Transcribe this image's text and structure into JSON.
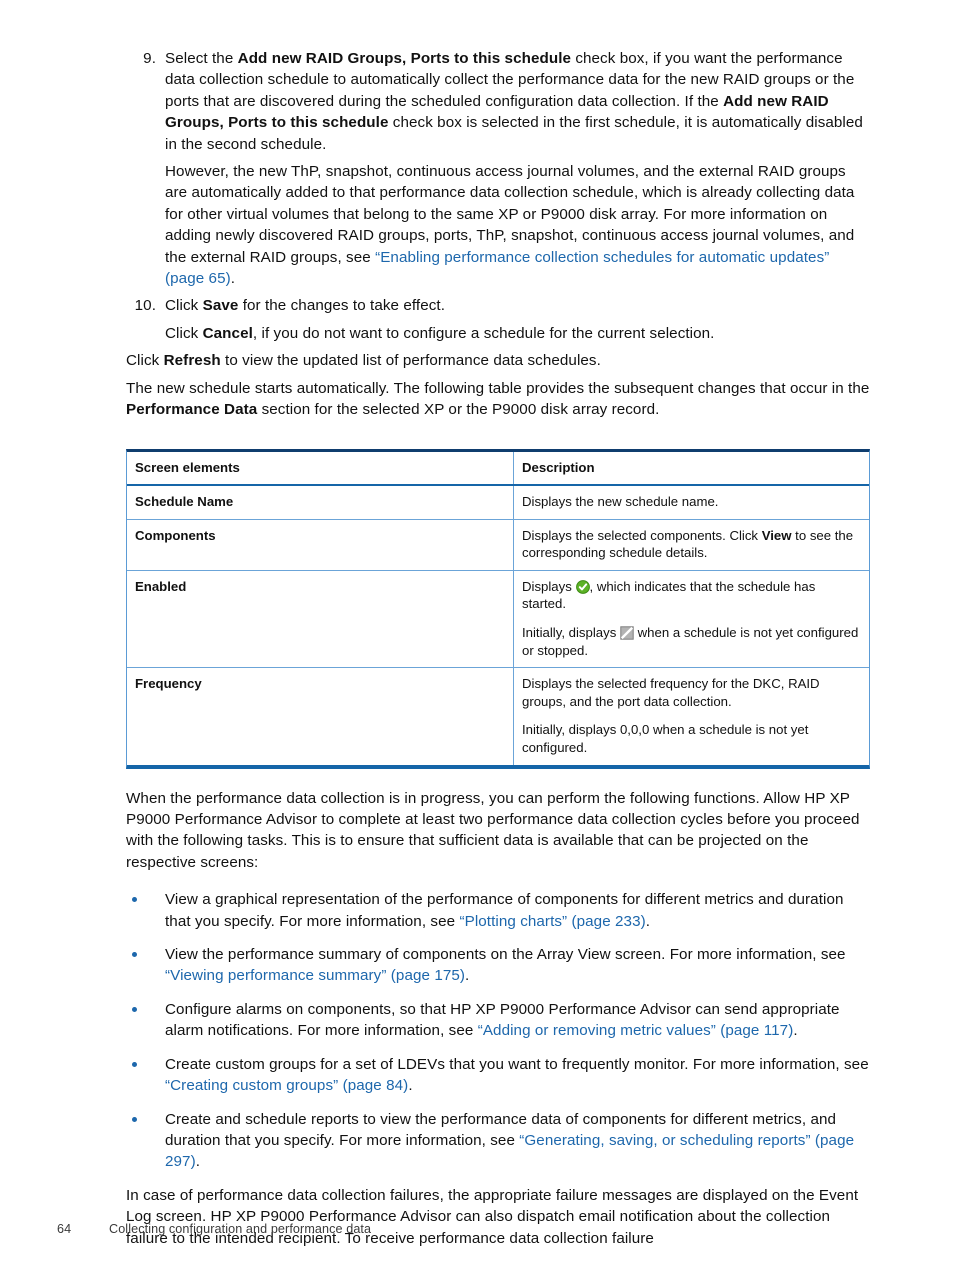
{
  "page": {
    "number": "64",
    "footer_title": "Collecting configuration and performance data"
  },
  "colors": {
    "link": "#1d67ac",
    "table_top_border": "#0f3d6e",
    "table_bottom_border": "#1565a8",
    "table_inner_border": "#6ba4d8",
    "bullet": "#1d67ac",
    "enabled_icon_green": "#5cb226",
    "disabled_icon_gray": "#9a9a9a"
  },
  "steps": [
    {
      "number": "9.",
      "paragraphs": [
        {
          "runs": [
            {
              "t": "Select the ",
              "s": "normal"
            },
            {
              "t": "Add new RAID Groups, Ports to this schedule",
              "s": "bold"
            },
            {
              "t": " check box, if you want the performance data collection schedule to automatically collect the performance data for the new RAID groups or the ports that are discovered during the scheduled configuration data collection. If the ",
              "s": "normal"
            },
            {
              "t": "Add new RAID Groups, Ports to this schedule",
              "s": "bold"
            },
            {
              "t": " check box is selected in the first schedule, it is automatically disabled in the second schedule.",
              "s": "normal"
            }
          ]
        },
        {
          "runs": [
            {
              "t": "However, the new ThP, snapshot, continuous access journal volumes, and the external RAID groups are automatically added to that performance data collection schedule, which is already collecting data for other virtual volumes that belong to the same XP or P9000 disk array. For more information on adding newly discovered RAID groups, ports, ThP, snapshot, continuous access journal volumes, and the external RAID groups, see ",
              "s": "normal"
            },
            {
              "t": "“Enabling performance collection schedules for automatic updates” (page 65)",
              "s": "link"
            },
            {
              "t": ".",
              "s": "normal"
            }
          ]
        }
      ]
    },
    {
      "number": "10.",
      "paragraphs": [
        {
          "runs": [
            {
              "t": "Click ",
              "s": "normal"
            },
            {
              "t": "Save",
              "s": "bold"
            },
            {
              "t": " for the changes to take effect.",
              "s": "normal"
            }
          ]
        },
        {
          "runs": [
            {
              "t": "Click ",
              "s": "normal"
            },
            {
              "t": "Cancel",
              "s": "bold"
            },
            {
              "t": ", if you do not want to configure a schedule for the current selection.",
              "s": "normal"
            }
          ]
        }
      ]
    }
  ],
  "after_steps": [
    {
      "runs": [
        {
          "t": "Click ",
          "s": "normal"
        },
        {
          "t": "Refresh",
          "s": "bold"
        },
        {
          "t": " to view the updated list of performance data schedules.",
          "s": "normal"
        }
      ]
    },
    {
      "runs": [
        {
          "t": "The new schedule starts automatically. The following table provides the subsequent changes that occur in the ",
          "s": "normal"
        },
        {
          "t": "Performance Data",
          "s": "bold"
        },
        {
          "t": " section for the selected XP or the P9000 disk array record.",
          "s": "normal"
        }
      ]
    }
  ],
  "table": {
    "headers": [
      "Screen elements",
      "Description"
    ],
    "rows": [
      {
        "name": "Schedule Name",
        "description": [
          {
            "runs": [
              {
                "t": "Displays the new schedule name.",
                "s": "normal"
              }
            ]
          }
        ]
      },
      {
        "name": "Components",
        "description": [
          {
            "runs": [
              {
                "t": "Displays the selected components. Click ",
                "s": "normal"
              },
              {
                "t": "View",
                "s": "bold"
              },
              {
                "t": " to see the corresponding schedule details.",
                "s": "normal"
              }
            ]
          }
        ]
      },
      {
        "name": "Enabled",
        "description": [
          {
            "runs": [
              {
                "t": "Displays ",
                "s": "normal"
              },
              {
                "t": "green-check-circle-icon",
                "s": "icon"
              },
              {
                "t": ", which indicates that the schedule has started.",
                "s": "normal"
              }
            ]
          },
          {
            "runs": [
              {
                "t": "Initially, displays ",
                "s": "normal"
              },
              {
                "t": "gray-slash-square-icon",
                "s": "icon"
              },
              {
                "t": " when a schedule is not yet configured or stopped.",
                "s": "normal"
              }
            ]
          }
        ]
      },
      {
        "name": "Frequency",
        "description": [
          {
            "runs": [
              {
                "t": "Displays the selected frequency for the DKC, RAID groups, and the port data collection.",
                "s": "normal"
              }
            ]
          },
          {
            "runs": [
              {
                "t": "Initially, displays 0,0,0 when a schedule is not yet configured.",
                "s": "normal"
              }
            ]
          }
        ]
      }
    ]
  },
  "intro_after_table": {
    "runs": [
      {
        "t": "When the performance data collection is in progress, you can perform the following functions. Allow HP XP P9000 Performance Advisor to complete at least two performance data collection cycles before you proceed with the following tasks. This is to ensure that sufficient data is available that can be projected on the respective screens:",
        "s": "normal"
      }
    ]
  },
  "bullets": [
    {
      "runs": [
        {
          "t": "View a graphical representation of the performance of components for different metrics and duration that you specify. For more information, see ",
          "s": "normal"
        },
        {
          "t": "“Plotting charts” (page 233)",
          "s": "link"
        },
        {
          "t": ".",
          "s": "normal"
        }
      ]
    },
    {
      "runs": [
        {
          "t": "View the performance summary of components on the Array View screen. For more information, see ",
          "s": "normal"
        },
        {
          "t": "“Viewing performance summary” (page 175)",
          "s": "link"
        },
        {
          "t": ".",
          "s": "normal"
        }
      ]
    },
    {
      "runs": [
        {
          "t": "Configure alarms on components, so that HP XP P9000 Performance Advisor can send appropriate alarm notifications. For more information, see ",
          "s": "normal"
        },
        {
          "t": "“Adding or removing metric values” (page 117)",
          "s": "link"
        },
        {
          "t": ".",
          "s": "normal"
        }
      ]
    },
    {
      "runs": [
        {
          "t": "Create custom groups for a set of LDEVs that you want to frequently monitor. For more information, see ",
          "s": "normal"
        },
        {
          "t": "“Creating custom groups” (page 84)",
          "s": "link"
        },
        {
          "t": ".",
          "s": "normal"
        }
      ]
    },
    {
      "runs": [
        {
          "t": "Create and schedule reports to view the performance data of components for different metrics, and duration that you specify. For more information, see ",
          "s": "normal"
        },
        {
          "t": "“Generating, saving, or scheduling reports” (page 297)",
          "s": "link"
        },
        {
          "t": ".",
          "s": "normal"
        }
      ]
    }
  ],
  "closing": {
    "runs": [
      {
        "t": "In case of performance data collection failures, the appropriate failure messages are displayed on the Event Log screen. HP XP P9000 Performance Advisor can also dispatch email notification about the collection failure to the intended recipient. To receive performance data collection failure",
        "s": "normal"
      }
    ]
  }
}
